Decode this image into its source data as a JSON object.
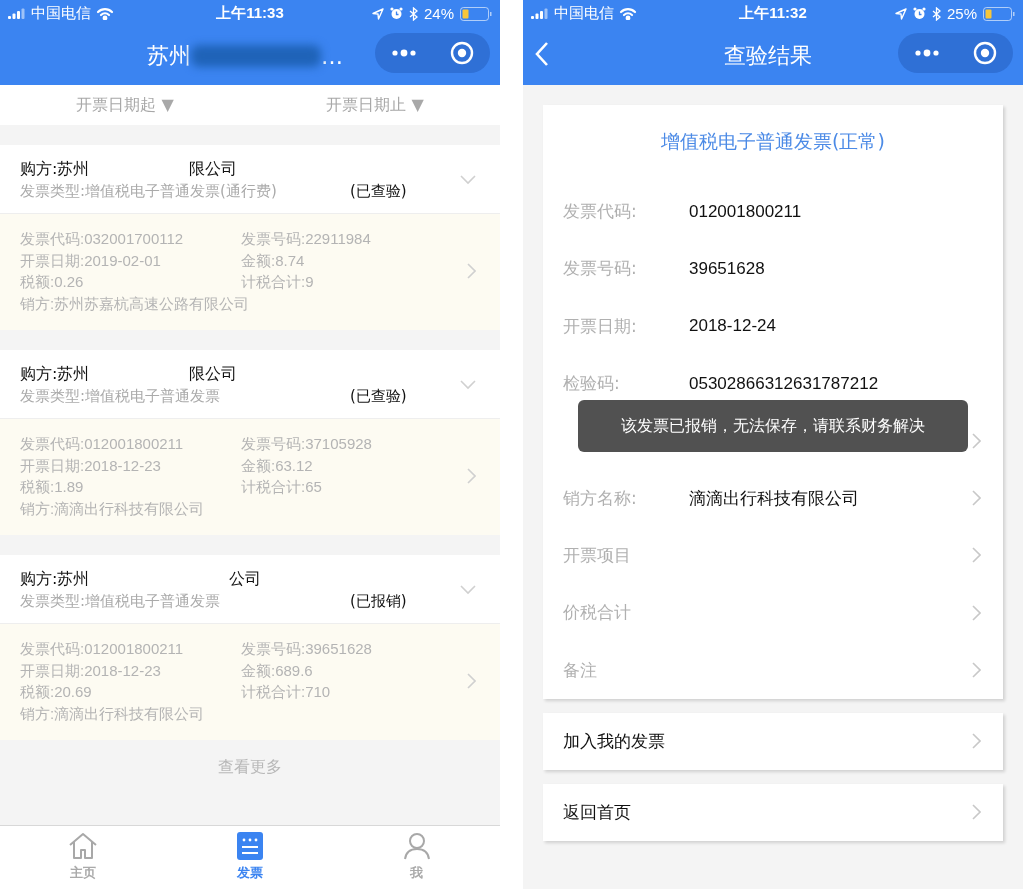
{
  "left_phone": {
    "status_bar": {
      "carrier": "中国电信",
      "time": "上午11:33",
      "battery": "24%"
    },
    "title_start": "苏州",
    "title_end": "…",
    "filters": [
      {
        "label": "开票日期起 ▼"
      },
      {
        "label": "开票日期止 ▼"
      }
    ],
    "invoices": [
      {
        "buyer_start": "购方:苏州",
        "buyer_end": "限公司",
        "type": "发票类型:增值税电子普通发票(通行费)",
        "status": "(已查验)",
        "fields": [
          "发票代码:032001700112",
          "发票号码:22911984",
          "开票日期:2019-02-01",
          "金额:8.74",
          "税额:0.26",
          "计税合计:9"
        ],
        "seller": "销方:苏州苏嘉杭高速公路有限公司"
      },
      {
        "buyer_start": "购方:苏州",
        "buyer_end": "限公司",
        "type": "发票类型:增值税电子普通发票",
        "status": "(已查验)",
        "fields": [
          "发票代码:012001800211",
          "发票号码:37105928",
          "开票日期:2018-12-23",
          "金额:63.12",
          "税额:1.89",
          "计税合计:65"
        ],
        "seller": "销方:滴滴出行科技有限公司"
      },
      {
        "buyer_start": "购方:苏州",
        "buyer_end": "公司",
        "type": "发票类型:增值税电子普通发票",
        "status": "(已报销)",
        "fields": [
          "发票代码:012001800211",
          "发票号码:39651628",
          "开票日期:2018-12-23",
          "金额:689.6",
          "税额:20.69",
          "计税合计:710"
        ],
        "seller": "销方:滴滴出行科技有限公司"
      }
    ],
    "load_more": "查看更多",
    "tabs": [
      {
        "label": "主页",
        "kind": "home",
        "selected": false
      },
      {
        "label": "发票",
        "kind": "invoice",
        "selected": true
      },
      {
        "label": "我",
        "kind": "user",
        "selected": false
      }
    ]
  },
  "right_phone": {
    "status_bar": {
      "carrier": "中国电信",
      "time": "上午11:32",
      "battery": "25%"
    },
    "title": "查验结果",
    "heading": "增值税电子普通发票(正常)",
    "rows": [
      {
        "label": "发票代码:",
        "value": "012001800211",
        "has_arrow": false
      },
      {
        "label": "发票号码:",
        "value": "39651628",
        "has_arrow": false
      },
      {
        "label": "开票日期:",
        "value": "2018-12-24",
        "has_arrow": false
      },
      {
        "label": "检验码:",
        "value": "05302866312631787212",
        "has_arrow": false
      },
      {
        "has_arrow": true
      },
      {
        "label": "销方名称:",
        "value": "滴滴出行科技有限公司",
        "has_arrow": true
      },
      {
        "label": "开票项目",
        "has_arrow": true
      },
      {
        "label": "价税合计",
        "has_arrow": true
      },
      {
        "label": "备注",
        "has_arrow": true
      }
    ],
    "toast": "该发票已报销，无法保存，请联系财务解决",
    "actions": [
      {
        "label": "加入我的发票"
      },
      {
        "label": "返回首页"
      }
    ]
  }
}
